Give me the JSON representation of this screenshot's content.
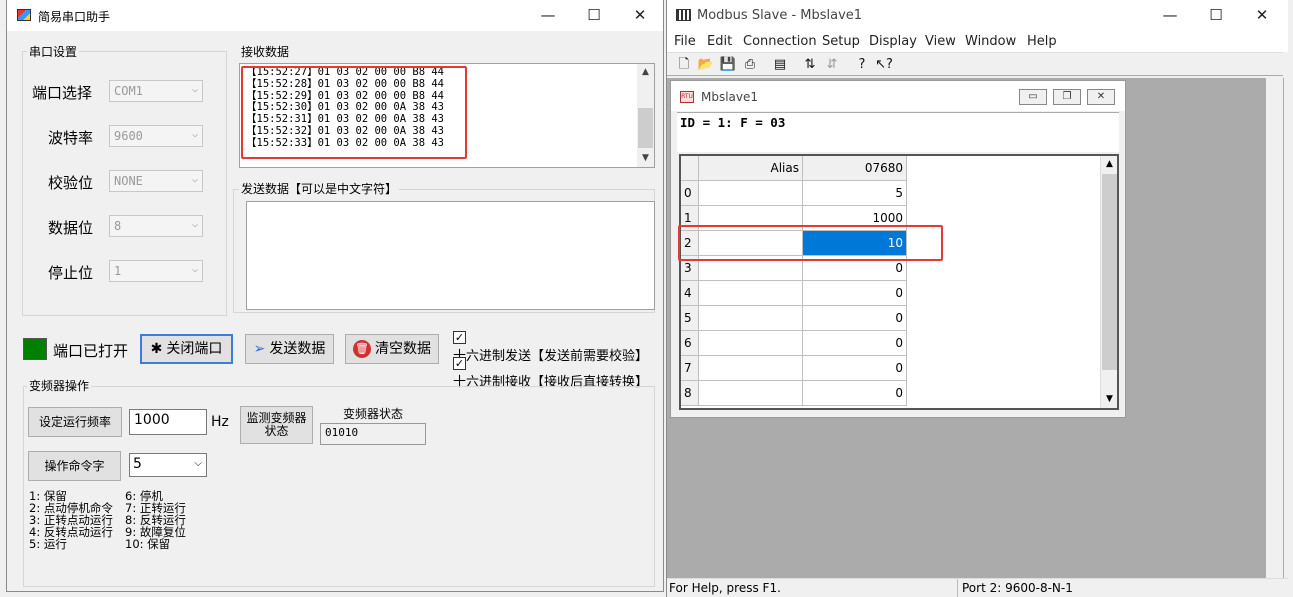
{
  "serial": {
    "title": "简易串口助手",
    "window_controls": {
      "minimize": "—",
      "maximize": "☐",
      "close": "✕"
    },
    "port_settings": {
      "group_label": "串口设置",
      "fields": [
        {
          "label": "端口选择",
          "value": "COM1"
        },
        {
          "label": "波特率",
          "value": "9600"
        },
        {
          "label": "校验位",
          "value": "NONE"
        },
        {
          "label": "数据位",
          "value": "8"
        },
        {
          "label": "停止位",
          "value": "1"
        }
      ]
    },
    "receive": {
      "group_label": "接收数据",
      "lines": [
        "【15:52:27】01 03 02 00 00 B8 44",
        "【15:52:28】01 03 02 00 00 B8 44",
        "【15:52:29】01 03 02 00 00 B8 44",
        "【15:52:30】01 03 02 00 0A 38 43",
        "【15:52:31】01 03 02 00 0A 38 43",
        "【15:52:32】01 03 02 00 0A 38 43",
        "【15:52:33】01 03 02 00 0A 38 43"
      ]
    },
    "send": {
      "group_label": "发送数据【可以是中文字符】",
      "value": ""
    },
    "status_text": "端口已打开",
    "status_color": "#008000",
    "buttons": {
      "close_port": "关闭端口",
      "send": "发送数据",
      "clear": "清空数据"
    },
    "checkboxes": {
      "hex_send": "十六进制发送【发送前需要校验】",
      "hex_receive": "十六进制接收【接收后直接转换】"
    },
    "inverter": {
      "group_label": "变频器操作",
      "set_freq_button": "设定运行频率",
      "freq_value": "1000",
      "freq_unit": "Hz",
      "monitor_button": "监测变频器状态",
      "status_label": "变频器状态",
      "status_value": "01010",
      "command_button": "操作命令字",
      "command_value": "5",
      "legend_left": [
        "1: 保留",
        "2: 点动停机命令",
        "3: 正转点动运行",
        "4: 反转点动运行",
        "5: 运行"
      ],
      "legend_right": [
        "6: 停机",
        "7: 正转运行",
        "8: 反转运行",
        "9: 故障复位",
        "10: 保留"
      ]
    }
  },
  "modbus": {
    "title": "Modbus Slave - Mbslave1",
    "window_controls": {
      "minimize": "—",
      "maximize": "☐",
      "close": "✕"
    },
    "menu": [
      "File",
      "Edit",
      "Connection",
      "Setup",
      "Display",
      "View",
      "Window",
      "Help"
    ],
    "toolbar_icons": [
      "new-icon",
      "open-icon",
      "save-icon",
      "print-icon",
      "window-icon",
      "connect-icon",
      "disconnect-icon",
      "help-icon",
      "context-help-icon"
    ],
    "child": {
      "title": "Mbslave1",
      "controls": {
        "minimize": "▭",
        "restore": "❐",
        "close": "✕"
      },
      "info": "ID = 1: F = 03",
      "headers": {
        "alias": "Alias",
        "value": "07680"
      },
      "rows": [
        {
          "n": "0",
          "v": "5"
        },
        {
          "n": "1",
          "v": "1000"
        },
        {
          "n": "2",
          "v": "10"
        },
        {
          "n": "3",
          "v": "0"
        },
        {
          "n": "4",
          "v": "0"
        },
        {
          "n": "5",
          "v": "0"
        },
        {
          "n": "6",
          "v": "0"
        },
        {
          "n": "7",
          "v": "0"
        },
        {
          "n": "8",
          "v": "0"
        }
      ]
    },
    "status": {
      "help": "For Help, press F1.",
      "port": "Port 2: 9600-8-N-1"
    }
  }
}
